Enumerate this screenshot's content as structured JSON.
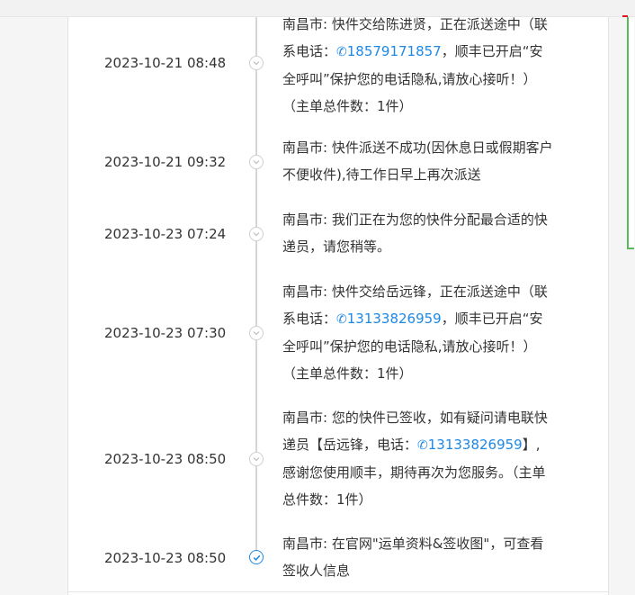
{
  "events": [
    {
      "time": "2023-10-21 08:48",
      "line1": "南昌市: 快件交给陈进贤，正在派送途中（联",
      "pre": "系电话：",
      "phone": "18579171857",
      "post": "，顺丰已开启“安",
      "line3": "全呼叫”保护您的电话隐私,请放心接听！）",
      "line4": "（主单总件数：1件）"
    },
    {
      "time": "2023-10-21 09:32",
      "line1": "南昌市: 快件派送不成功(因休息日或假期客户",
      "line2": "不便收件),待工作日早上再次派送"
    },
    {
      "time": "2023-10-23 07:24",
      "line1": "南昌市: 我们正在为您的快件分配最合适的快",
      "line2": "递员，请您稍等。"
    },
    {
      "time": "2023-10-23 07:30",
      "line1": "南昌市: 快件交给岳远锋，正在派送途中（联",
      "pre": "系电话：",
      "phone": "13133826959",
      "post": "，顺丰已开启“安",
      "line3": "全呼叫”保护您的电话隐私,请放心接听！）",
      "line4": "（主单总件数：1件）"
    },
    {
      "time": "2023-10-23 08:50",
      "line1": "南昌市: 您的快件已签收，如有疑问请电联快",
      "pre": "递员【岳远锋，电话：",
      "phone": "13133826959",
      "post": "】,",
      "line3": "感谢您使用顺丰，期待再次为您服务。（主单",
      "line4": "总件数：1件）"
    },
    {
      "time": "2023-10-23 08:50",
      "line1": "南昌市: 在官网\"运单资料&签收图\"，可查看",
      "line2": "签收人信息"
    }
  ],
  "icons": {
    "phone": "phone-icon",
    "pending": "chevron-down-icon",
    "done": "check-icon"
  },
  "colors": {
    "link": "#1e88e5",
    "line": "#d6d6d6",
    "accent_green": "#5cb85c"
  }
}
